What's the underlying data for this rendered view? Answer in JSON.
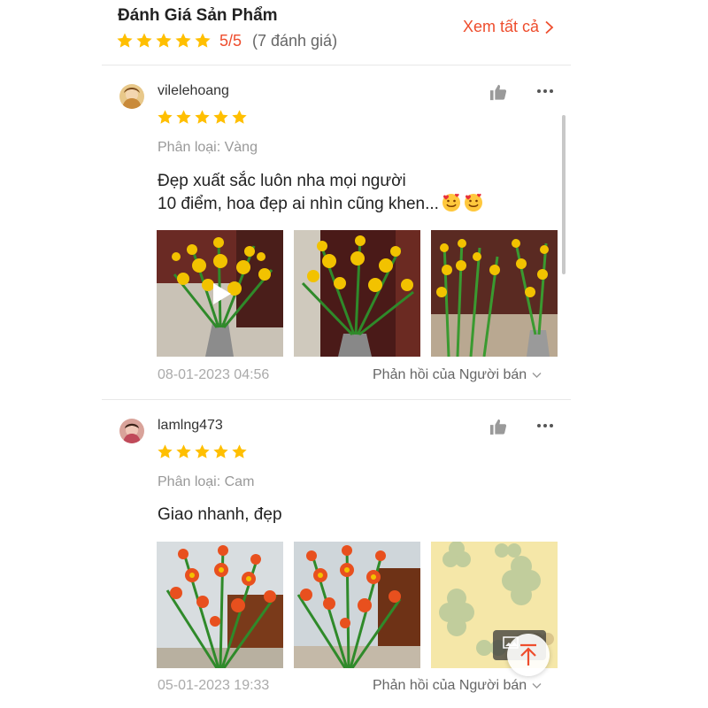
{
  "header": {
    "title": "Đánh Giá Sản Phẩm",
    "score": "5/5",
    "count": "(7 đánh giá)",
    "see_all": "Xem tất cả",
    "stars": 5
  },
  "reviews": [
    {
      "username": "vilelehoang",
      "stars": 5,
      "variant": "Phân loại: Vàng",
      "comment_lines": [
        "Đẹp xuất sắc luôn nha mọi người",
        "10 điểm, hoa đẹp ai nhìn cũng khen..."
      ],
      "emoji": "smiling-face-with-hearts",
      "photos": [
        "yellow-gladiolus-video",
        "yellow-gladiolus-vase",
        "yellow-gladiolus-bunch"
      ],
      "date": "08-01-2023 04:56",
      "reply": "Phản hồi của Người bán"
    },
    {
      "username": "lamlng473",
      "stars": 5,
      "variant": "Phân loại: Cam",
      "comment_lines": [
        "Giao nhanh, đẹp"
      ],
      "photos": [
        "orange-gladiolus-1",
        "orange-gladiolus-2",
        "green-clover-pattern"
      ],
      "date": "05-01-2023 19:33",
      "reply": "Phản hồi của Người bán"
    }
  ],
  "colors": {
    "accent": "#ee4d2d",
    "star": "#ffbf00",
    "muted": "#999999"
  },
  "icons": [
    "star-icon",
    "chevron-right-icon",
    "thumbs-up-icon",
    "more-icon",
    "chevron-down-icon",
    "play-icon",
    "gallery-icon",
    "arrow-up-icon"
  ]
}
